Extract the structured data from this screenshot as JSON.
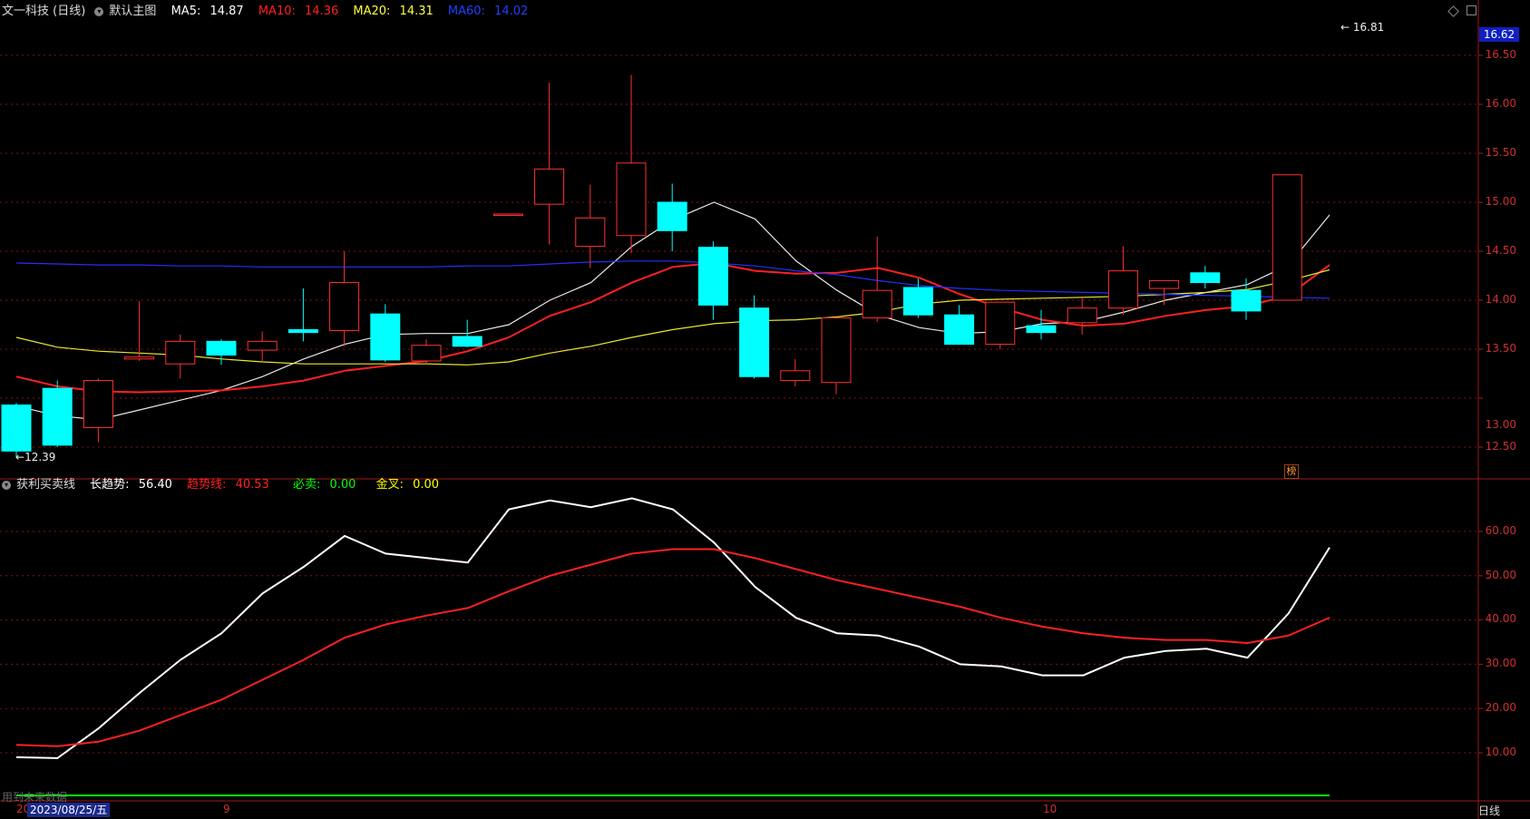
{
  "header": {
    "stock_name": "文一科技 (日线)",
    "main_chart_label": "默认主图",
    "ma5": {
      "label": "MA5:",
      "value": "14.87",
      "color": "#ffffff"
    },
    "ma10": {
      "label": "MA10:",
      "value": "14.36",
      "color": "#ff2020"
    },
    "ma20": {
      "label": "MA20:",
      "value": "14.31",
      "color": "#ffff40"
    },
    "ma60": {
      "label": "MA60:",
      "value": "14.02",
      "color": "#2040ff"
    }
  },
  "sub_header": {
    "indicator_name": "获利买卖线",
    "long_trend": {
      "label": "长趋势:",
      "value": "56.40",
      "color": "#ffffff"
    },
    "trend_line": {
      "label": "趋势线:",
      "value": "40.53",
      "color": "#ff2020"
    },
    "must_sell": {
      "label": "必卖:",
      "value": "0.00",
      "color": "#00ff00"
    },
    "golden_cross": {
      "label": "金叉:",
      "value": "0.00",
      "color": "#ffff00"
    }
  },
  "price_axis": {
    "ticks": [
      "16.50",
      "16.00",
      "15.50",
      "15.00",
      "14.50",
      "14.00",
      "13.50",
      "13.00",
      "12.50"
    ],
    "current_price": "16.62"
  },
  "indicator_axis": {
    "ticks": [
      "60.00",
      "50.00",
      "40.00",
      "30.00",
      "20.00",
      "10.00"
    ]
  },
  "annotations": {
    "high_label": "16.81",
    "low_label": "12.39",
    "bang": "榜",
    "future_data": "用到未来数据"
  },
  "x_axis": {
    "labels": [
      "20",
      "9",
      "10"
    ],
    "cursor_date": "2023/08/25/五"
  },
  "period_button": "日线",
  "colors": {
    "up": "#ff3030",
    "down": "#00ffff",
    "grid": "#8a1010",
    "frame": "#a01818"
  },
  "chart_data": [
    {
      "type": "candlestick",
      "ylim": [
        12.2,
        16.9
      ],
      "candles": [
        {
          "o": 12.93,
          "h": 12.95,
          "l": 12.39,
          "c": 12.46
        },
        {
          "o": 13.1,
          "h": 13.18,
          "l": 12.5,
          "c": 12.52
        },
        {
          "o": 12.7,
          "h": 13.2,
          "l": 12.55,
          "c": 13.18
        },
        {
          "o": 13.4,
          "h": 13.99,
          "l": 13.38,
          "c": 13.42
        },
        {
          "o": 13.35,
          "h": 13.65,
          "l": 13.2,
          "c": 13.58
        },
        {
          "o": 13.58,
          "h": 13.6,
          "l": 13.34,
          "c": 13.44
        },
        {
          "o": 13.49,
          "h": 13.68,
          "l": 13.38,
          "c": 13.58
        },
        {
          "o": 13.7,
          "h": 14.12,
          "l": 13.58,
          "c": 13.67
        },
        {
          "o": 13.69,
          "h": 14.5,
          "l": 13.53,
          "c": 14.18
        },
        {
          "o": 13.86,
          "h": 13.96,
          "l": 13.37,
          "c": 13.39
        },
        {
          "o": 13.38,
          "h": 13.6,
          "l": 13.35,
          "c": 13.54
        },
        {
          "o": 13.63,
          "h": 13.8,
          "l": 13.52,
          "c": 13.53
        },
        {
          "o": 14.88,
          "h": 14.88,
          "l": 14.88,
          "c": 14.88
        },
        {
          "o": 14.98,
          "h": 16.22,
          "l": 14.57,
          "c": 15.34
        },
        {
          "o": 14.55,
          "h": 15.18,
          "l": 14.33,
          "c": 14.84
        },
        {
          "o": 14.66,
          "h": 16.3,
          "l": 14.48,
          "c": 15.4
        },
        {
          "o": 15.0,
          "h": 15.19,
          "l": 14.5,
          "c": 14.71
        },
        {
          "o": 14.54,
          "h": 14.6,
          "l": 13.8,
          "c": 13.95
        },
        {
          "o": 13.92,
          "h": 14.05,
          "l": 13.2,
          "c": 13.22
        },
        {
          "o": 13.18,
          "h": 13.4,
          "l": 13.12,
          "c": 13.28
        },
        {
          "o": 13.16,
          "h": 13.82,
          "l": 13.04,
          "c": 13.82
        },
        {
          "o": 13.82,
          "h": 14.65,
          "l": 13.78,
          "c": 14.1
        },
        {
          "o": 14.13,
          "h": 14.22,
          "l": 13.82,
          "c": 13.85
        },
        {
          "o": 13.85,
          "h": 13.95,
          "l": 13.55,
          "c": 13.55
        },
        {
          "o": 13.55,
          "h": 13.98,
          "l": 13.5,
          "c": 13.98
        },
        {
          "o": 13.74,
          "h": 13.9,
          "l": 13.6,
          "c": 13.67
        },
        {
          "o": 13.77,
          "h": 14.02,
          "l": 13.65,
          "c": 13.92
        },
        {
          "o": 13.92,
          "h": 14.55,
          "l": 13.85,
          "c": 14.3
        },
        {
          "o": 14.12,
          "h": 14.2,
          "l": 13.95,
          "c": 14.2
        },
        {
          "o": 14.28,
          "h": 14.35,
          "l": 14.12,
          "c": 14.18
        },
        {
          "o": 14.1,
          "h": 14.22,
          "l": 13.8,
          "c": 13.89
        },
        {
          "o": 14.0,
          "h": 15.28,
          "l": 14.0,
          "c": 15.28
        }
      ],
      "ma_lines": [
        {
          "name": "MA5",
          "color": "#e8e8e8",
          "values": [
            12.92,
            12.82,
            12.78,
            12.88,
            12.98,
            13.08,
            13.22,
            13.4,
            13.55,
            13.65,
            13.66,
            13.66,
            13.75,
            14.0,
            14.18,
            14.55,
            14.82,
            15.0,
            14.83,
            14.4,
            14.1,
            13.85,
            13.72,
            13.66,
            13.68,
            13.76,
            13.78,
            13.88,
            14.0,
            14.08,
            14.16,
            14.36,
            14.87
          ]
        },
        {
          "name": "MA10",
          "color": "#ff2020",
          "values": [
            13.22,
            13.12,
            13.07,
            13.06,
            13.07,
            13.08,
            13.12,
            13.18,
            13.28,
            13.33,
            13.38,
            13.48,
            13.62,
            13.84,
            13.98,
            14.18,
            14.34,
            14.38,
            14.3,
            14.27,
            14.28,
            14.33,
            14.23,
            14.06,
            13.92,
            13.8,
            13.74,
            13.76,
            13.84,
            13.9,
            13.94,
            14.05,
            14.36
          ]
        },
        {
          "name": "MA20",
          "color": "#e8e830",
          "values": [
            13.62,
            13.52,
            13.48,
            13.46,
            13.44,
            13.4,
            13.37,
            13.35,
            13.35,
            13.35,
            13.35,
            13.34,
            13.37,
            13.46,
            13.53,
            13.62,
            13.7,
            13.76,
            13.79,
            13.8,
            13.83,
            13.88,
            13.96,
            14.0,
            14.01,
            14.02,
            14.03,
            14.04,
            14.06,
            14.08,
            14.11,
            14.2,
            14.31
          ]
        },
        {
          "name": "MA60",
          "color": "#2030ff",
          "values": [
            14.38,
            14.37,
            14.36,
            14.36,
            14.35,
            14.35,
            14.34,
            14.34,
            14.34,
            14.34,
            14.34,
            14.35,
            14.35,
            14.37,
            14.39,
            14.4,
            14.4,
            14.38,
            14.35,
            14.3,
            14.26,
            14.2,
            14.15,
            14.12,
            14.1,
            14.09,
            14.08,
            14.07,
            14.06,
            14.05,
            14.04,
            14.03,
            14.02
          ]
        }
      ]
    },
    {
      "type": "line",
      "ylim": [
        0,
        70
      ],
      "series": [
        {
          "name": "长趋势",
          "color": "#ffffff",
          "values": [
            9,
            8.8,
            15.5,
            23.5,
            31,
            37,
            46,
            52,
            59,
            55,
            54,
            53,
            65,
            67,
            65.5,
            67.5,
            65,
            57.5,
            47.5,
            40.5,
            37,
            36.5,
            34,
            30,
            29.5,
            27.5,
            27.5,
            31.5,
            33,
            33.5,
            31.5,
            41.5,
            56.4
          ]
        },
        {
          "name": "趋势线",
          "color": "#ff2020",
          "values": [
            11.8,
            11.5,
            12.5,
            15,
            18.5,
            22,
            26.5,
            31,
            36,
            39,
            41,
            42.7,
            46.5,
            50,
            52.5,
            55,
            56,
            56,
            54,
            51.5,
            49,
            47,
            45,
            43,
            40.5,
            38.5,
            37,
            36,
            35.5,
            35.5,
            34.8,
            36.5,
            40.53
          ]
        },
        {
          "name": "必卖",
          "color": "#00ff00",
          "values": [
            0,
            0,
            0,
            0,
            0,
            0,
            0,
            0,
            0,
            0,
            0,
            0,
            0,
            0,
            0,
            0,
            0,
            0,
            0,
            0,
            0,
            0,
            0,
            0,
            0,
            0,
            0,
            0,
            0,
            0,
            0,
            0,
            0
          ]
        }
      ]
    }
  ]
}
